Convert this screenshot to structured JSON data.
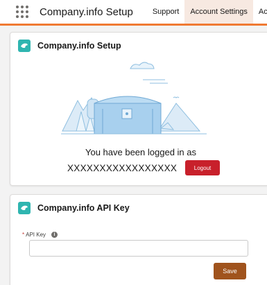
{
  "topbar": {
    "app_title": "Company.info Setup",
    "tabs": [
      {
        "label": "Support",
        "active": false
      },
      {
        "label": "Account Settings",
        "active": true
      },
      {
        "label": "Acce",
        "active": false
      }
    ],
    "accent_color": "#f07a33"
  },
  "login_card": {
    "title": "Company.info Setup",
    "message": "You have been logged in as",
    "username": "XXXXXXXXXXXXXXXXX",
    "logout_label": "Logout"
  },
  "api_card": {
    "title": "Company.info API Key",
    "required_marker": "*",
    "field_label": "API Key",
    "info_glyph": "i",
    "api_key_value": "",
    "save_label": "Save"
  },
  "colors": {
    "brand_icon": "#2fb5b0",
    "logout_button": "#c8202b",
    "save_button": "#a0531d"
  }
}
